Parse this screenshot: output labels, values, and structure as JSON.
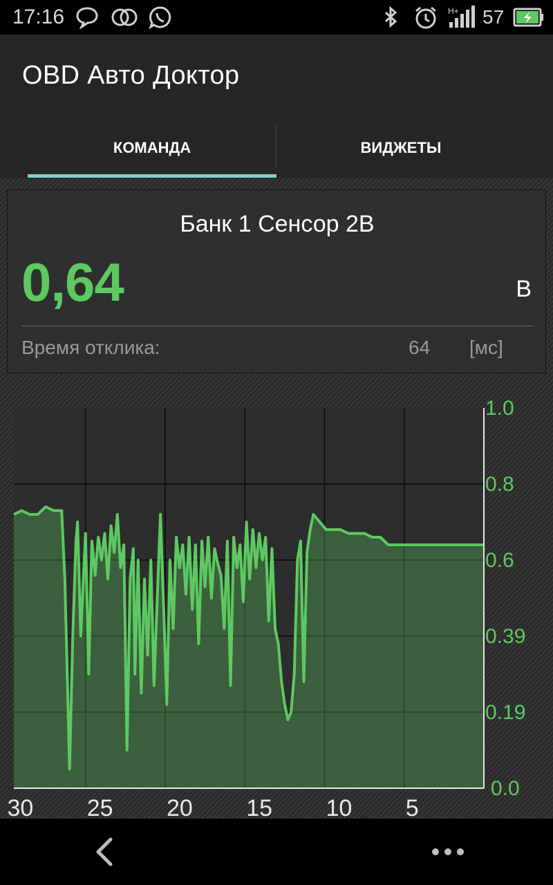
{
  "status_bar": {
    "time": "17:16",
    "left_icons": [
      "chat-bubble-icon",
      "link-rings-icon",
      "whatsapp-icon"
    ],
    "right_icons": [
      "bluetooth-icon",
      "alarm-icon",
      "signal-icon",
      "battery-icon"
    ],
    "signal_type": "H+",
    "battery_level": "57",
    "battery_color": "#5dc961"
  },
  "app": {
    "title": "OBD Авто Доктор"
  },
  "tabs": [
    {
      "label": "КОМАНДА",
      "selected": true
    },
    {
      "label": "ВИДЖЕТЫ",
      "selected": false
    }
  ],
  "sensor": {
    "name": "Банк 1 Сенсор 2В",
    "value": "0,64",
    "unit": "В",
    "response_label": "Время отклика:",
    "response_value": "64",
    "response_unit": "[мс]"
  },
  "colors": {
    "accent_green": "#5dc961",
    "tab_indicator": "#7fd0c8"
  },
  "chart_data": {
    "type": "area",
    "x_ticks": [
      "30",
      "25",
      "20",
      "15",
      "10",
      "5"
    ],
    "y_ticks": [
      "0.0",
      "0.19",
      "0.39",
      "0.6",
      "0.8",
      "1.0"
    ],
    "xlim": [
      29.5,
      0
    ],
    "ylim": [
      0,
      1.0
    ],
    "grid": true,
    "series": [
      {
        "x": [
          29.5,
          29.0,
          28.5,
          28.0,
          27.5,
          27.0,
          26.5,
          26.3,
          26.0,
          25.8,
          25.6,
          25.5,
          25.3,
          25.0,
          24.8,
          24.6,
          24.4,
          24.2,
          24.0,
          23.8,
          23.6,
          23.4,
          23.2,
          23.0,
          22.8,
          22.6,
          22.4,
          22.2,
          22.0,
          21.9,
          21.7,
          21.5,
          21.3,
          21.1,
          20.9,
          20.7,
          20.5,
          20.3,
          20.1,
          19.9,
          19.7,
          19.5,
          19.3,
          19.1,
          18.9,
          18.7,
          18.5,
          18.3,
          18.1,
          17.9,
          17.7,
          17.5,
          17.3,
          17.1,
          16.9,
          16.7,
          16.5,
          16.3,
          16.1,
          15.9,
          15.7,
          15.5,
          15.3,
          15.1,
          14.9,
          14.7,
          14.5,
          14.3,
          14.1,
          13.9,
          13.7,
          13.5,
          13.3,
          13.1,
          12.9,
          12.7,
          12.5,
          12.3,
          12.1,
          11.9,
          11.7,
          11.5,
          11.3,
          11.1,
          10.9,
          10.7,
          10.5,
          10.3,
          10.1,
          9.9,
          9.5,
          9.0,
          8.5,
          8.0,
          7.5,
          7.0,
          6.5,
          6.0,
          5.0,
          4.0,
          3.0,
          2.0,
          1.0,
          0.0
        ],
        "y": [
          0.72,
          0.73,
          0.72,
          0.72,
          0.74,
          0.73,
          0.73,
          0.55,
          0.05,
          0.4,
          0.65,
          0.7,
          0.4,
          0.67,
          0.3,
          0.65,
          0.56,
          0.66,
          0.6,
          0.67,
          0.55,
          0.69,
          0.62,
          0.72,
          0.58,
          0.64,
          0.1,
          0.55,
          0.63,
          0.3,
          0.6,
          0.25,
          0.55,
          0.35,
          0.6,
          0.27,
          0.5,
          0.72,
          0.48,
          0.22,
          0.6,
          0.42,
          0.66,
          0.58,
          0.64,
          0.51,
          0.66,
          0.47,
          0.64,
          0.38,
          0.65,
          0.53,
          0.66,
          0.5,
          0.63,
          0.59,
          0.56,
          0.42,
          0.65,
          0.27,
          0.66,
          0.58,
          0.64,
          0.49,
          0.7,
          0.55,
          0.68,
          0.58,
          0.67,
          0.6,
          0.66,
          0.44,
          0.63,
          0.42,
          0.38,
          0.28,
          0.22,
          0.18,
          0.2,
          0.3,
          0.6,
          0.65,
          0.28,
          0.62,
          0.68,
          0.72,
          0.71,
          0.7,
          0.69,
          0.68,
          0.68,
          0.68,
          0.67,
          0.67,
          0.67,
          0.66,
          0.66,
          0.64,
          0.64,
          0.64,
          0.64,
          0.64,
          0.64,
          0.64
        ],
        "color": "#5dc961"
      }
    ]
  },
  "nav_bar": {
    "icons": [
      "back-chevron-icon",
      "overflow-menu-icon"
    ]
  }
}
